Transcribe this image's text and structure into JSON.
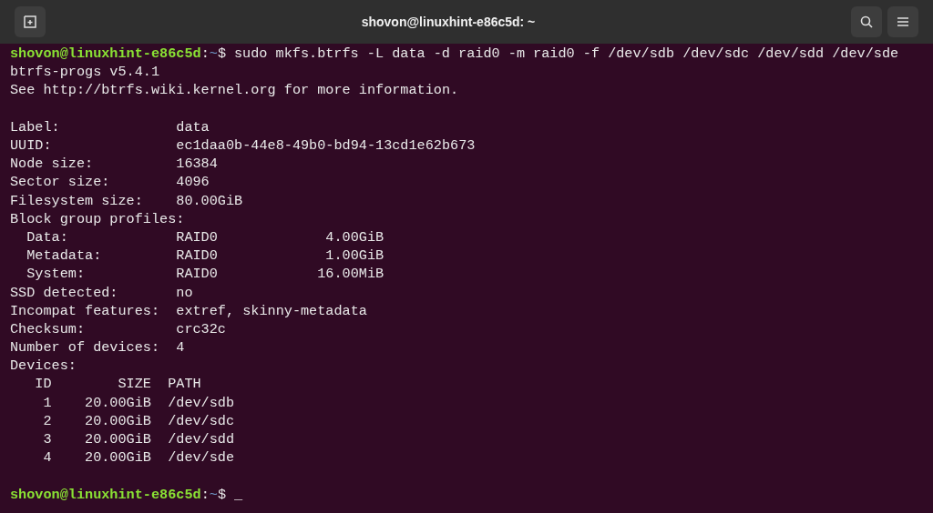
{
  "window": {
    "title": "shovon@linuxhint-e86c5d: ~"
  },
  "terminal": {
    "lines": [
      {
        "kind": "prompt",
        "user_host": "shovon@linuxhint-e86c5d",
        "separator": ":",
        "path": "~",
        "symbol": "$",
        "command": "sudo mkfs.btrfs -L data -d raid0 -m raid0 -f /dev/sdb /dev/sdc /dev/sdd /dev/sde"
      },
      {
        "kind": "output",
        "text": "btrfs-progs v5.4.1"
      },
      {
        "kind": "output",
        "text": "See http://btrfs.wiki.kernel.org for more information."
      },
      {
        "kind": "blank"
      },
      {
        "kind": "output",
        "text": "Label:              data"
      },
      {
        "kind": "output",
        "text": "UUID:               ec1daa0b-44e8-49b0-bd94-13cd1e62b673"
      },
      {
        "kind": "output",
        "text": "Node size:          16384"
      },
      {
        "kind": "output",
        "text": "Sector size:        4096"
      },
      {
        "kind": "output",
        "text": "Filesystem size:    80.00GiB"
      },
      {
        "kind": "output",
        "text": "Block group profiles:"
      },
      {
        "kind": "output",
        "text": "  Data:             RAID0             4.00GiB"
      },
      {
        "kind": "output",
        "text": "  Metadata:         RAID0             1.00GiB"
      },
      {
        "kind": "output",
        "text": "  System:           RAID0            16.00MiB"
      },
      {
        "kind": "output",
        "text": "SSD detected:       no"
      },
      {
        "kind": "output",
        "text": "Incompat features:  extref, skinny-metadata"
      },
      {
        "kind": "output",
        "text": "Checksum:           crc32c"
      },
      {
        "kind": "output",
        "text": "Number of devices:  4"
      },
      {
        "kind": "output",
        "text": "Devices:"
      },
      {
        "kind": "output",
        "text": "   ID        SIZE  PATH"
      },
      {
        "kind": "output",
        "text": "    1    20.00GiB  /dev/sdb"
      },
      {
        "kind": "output",
        "text": "    2    20.00GiB  /dev/sdc"
      },
      {
        "kind": "output",
        "text": "    3    20.00GiB  /dev/sdd"
      },
      {
        "kind": "output",
        "text": "    4    20.00GiB  /dev/sde"
      },
      {
        "kind": "blank"
      },
      {
        "kind": "prompt",
        "user_host": "shovon@linuxhint-e86c5d",
        "separator": ":",
        "path": "~",
        "symbol": "$",
        "cursor": "_"
      }
    ]
  }
}
